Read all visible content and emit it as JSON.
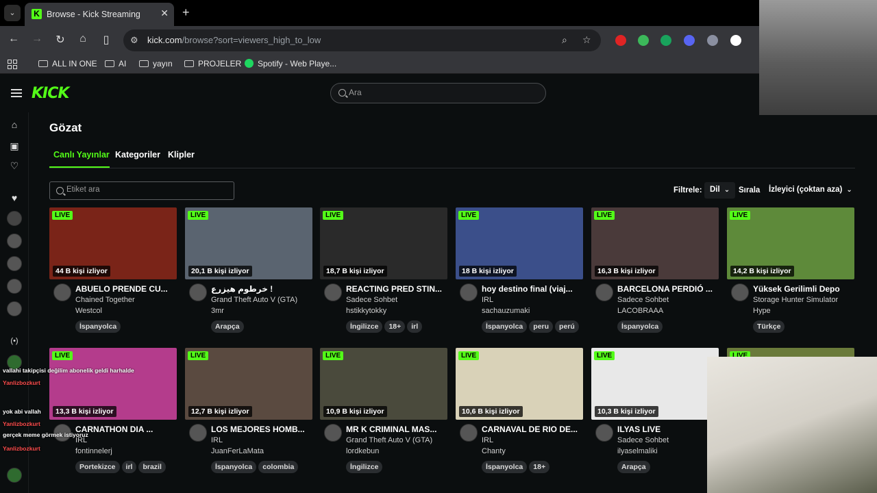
{
  "browser": {
    "tab_title": "Browse - Kick Streaming",
    "url_domain": "kick.com",
    "url_path": "/browse?sort=viewers_high_to_low",
    "bookmarks": [
      "ALL IN ONE",
      "AI",
      "yayın",
      "PROJELER",
      "Spotify - Web Playe..."
    ]
  },
  "header": {
    "logo": "KICK",
    "search_placeholder": "Ara"
  },
  "page": {
    "title": "Gözat",
    "tabs": [
      "Canlı Yayınlar",
      "Kategoriler",
      "Klipler"
    ],
    "tag_search_placeholder": "Etiket ara",
    "filter_label": "Filtrele:",
    "language_filter": "Dil",
    "sort_label": "Sırala",
    "sort_value": "İzleyici (çoktan aza)"
  },
  "streams": [
    {
      "live": "LIVE",
      "viewers": "44 B kişi izliyor",
      "title": "ABUELO PRENDE CU...",
      "category": "Chained Together",
      "channel": "Westcol",
      "tags": [
        "İspanyolca"
      ],
      "thumb_color": "#7a2418"
    },
    {
      "live": "LIVE",
      "viewers": "20,1 B kişi izliyor",
      "title": "خرطوم هيزرع !",
      "category": "Grand Theft Auto V (GTA)",
      "channel": "3mr",
      "tags": [
        "Arapça"
      ],
      "thumb_color": "#5a6470"
    },
    {
      "live": "LIVE",
      "viewers": "18,7 B kişi izliyor",
      "title": "REACTING PRED STIN...",
      "category": "Sadece Sohbet",
      "channel": "hstikkytokky",
      "tags": [
        "İngilizce",
        "18+",
        "irl"
      ],
      "thumb_color": "#2a2a2a"
    },
    {
      "live": "LIVE",
      "viewers": "18 B kişi izliyor",
      "title": "hoy destino final (viaj...",
      "category": "IRL",
      "channel": "sachauzumaki",
      "tags": [
        "İspanyolca",
        "peru",
        "perú"
      ],
      "thumb_color": "#3b4f8a"
    },
    {
      "live": "LIVE",
      "viewers": "16,3 B kişi izliyor",
      "title": "BARCELONA PERDIÓ ...",
      "category": "Sadece Sohbet",
      "channel": "LACOBRAAA",
      "tags": [
        "İspanyolca"
      ],
      "thumb_color": "#4a3a3a"
    },
    {
      "live": "LIVE",
      "viewers": "14,2 B kişi izliyor",
      "title": "Yüksek Gerilimli Depo",
      "category": "Storage Hunter Simulator",
      "channel": "Hype",
      "tags": [
        "Türkçe"
      ],
      "thumb_color": "#5e8a3a"
    },
    {
      "live": "LIVE",
      "viewers": "13,3 B kişi izliyor",
      "title": "CARNATHON DIA ...",
      "category": "IRL",
      "channel": "fontinnelerj",
      "tags": [
        "Portekizce",
        "irl",
        "brazil"
      ],
      "thumb_color": "#b43c8c"
    },
    {
      "live": "LIVE",
      "viewers": "12,7 B kişi izliyor",
      "title": "LOS MEJORES HOMB...",
      "category": "IRL",
      "channel": "JuanFerLaMata",
      "tags": [
        "İspanyolca",
        "colombia"
      ],
      "thumb_color": "#5a4a40"
    },
    {
      "live": "LIVE",
      "viewers": "10,9 B kişi izliyor",
      "title": "MR K CRIMINAL MAS...",
      "category": "Grand Theft Auto V (GTA)",
      "channel": "lordkebun",
      "tags": [
        "İngilizce"
      ],
      "thumb_color": "#4a4a3c"
    },
    {
      "live": "LIVE",
      "viewers": "10,6 B kişi izliyor",
      "title": "CARNAVAL DE RIO DE...",
      "category": "IRL",
      "channel": "Chanty",
      "tags": [
        "İspanyolca",
        "18+"
      ],
      "thumb_color": "#d9d2b8"
    },
    {
      "live": "LIVE",
      "viewers": "10,3 B kişi izliyor",
      "title": "ILYAS LIVE",
      "category": "Sadece Sohbet",
      "channel": "ilyaselmaliki",
      "tags": [
        "Arapça"
      ],
      "thumb_color": "#e8e8e8"
    },
    {
      "live": "LIVE",
      "viewers": "",
      "title": "",
      "category": "",
      "channel": "",
      "tags": [],
      "thumb_color": "#6a7a3a"
    }
  ],
  "chat_overlay": [
    {
      "user": "",
      "text": "vallahi takipçisi değilim abonelik geldi harhalde"
    },
    {
      "user": "Yanlizbozkurt",
      "text": ""
    },
    {
      "user": "",
      "text": "yok abi vallah"
    },
    {
      "user": "Yanlizbozkurt",
      "text": ""
    },
    {
      "user": "",
      "text": "gerçek meme görmek istiyoruz"
    },
    {
      "user": "Yanlizbozkurt",
      "text": ""
    }
  ],
  "colors": {
    "accent": "#53fc18",
    "background": "#0b0e0f"
  }
}
